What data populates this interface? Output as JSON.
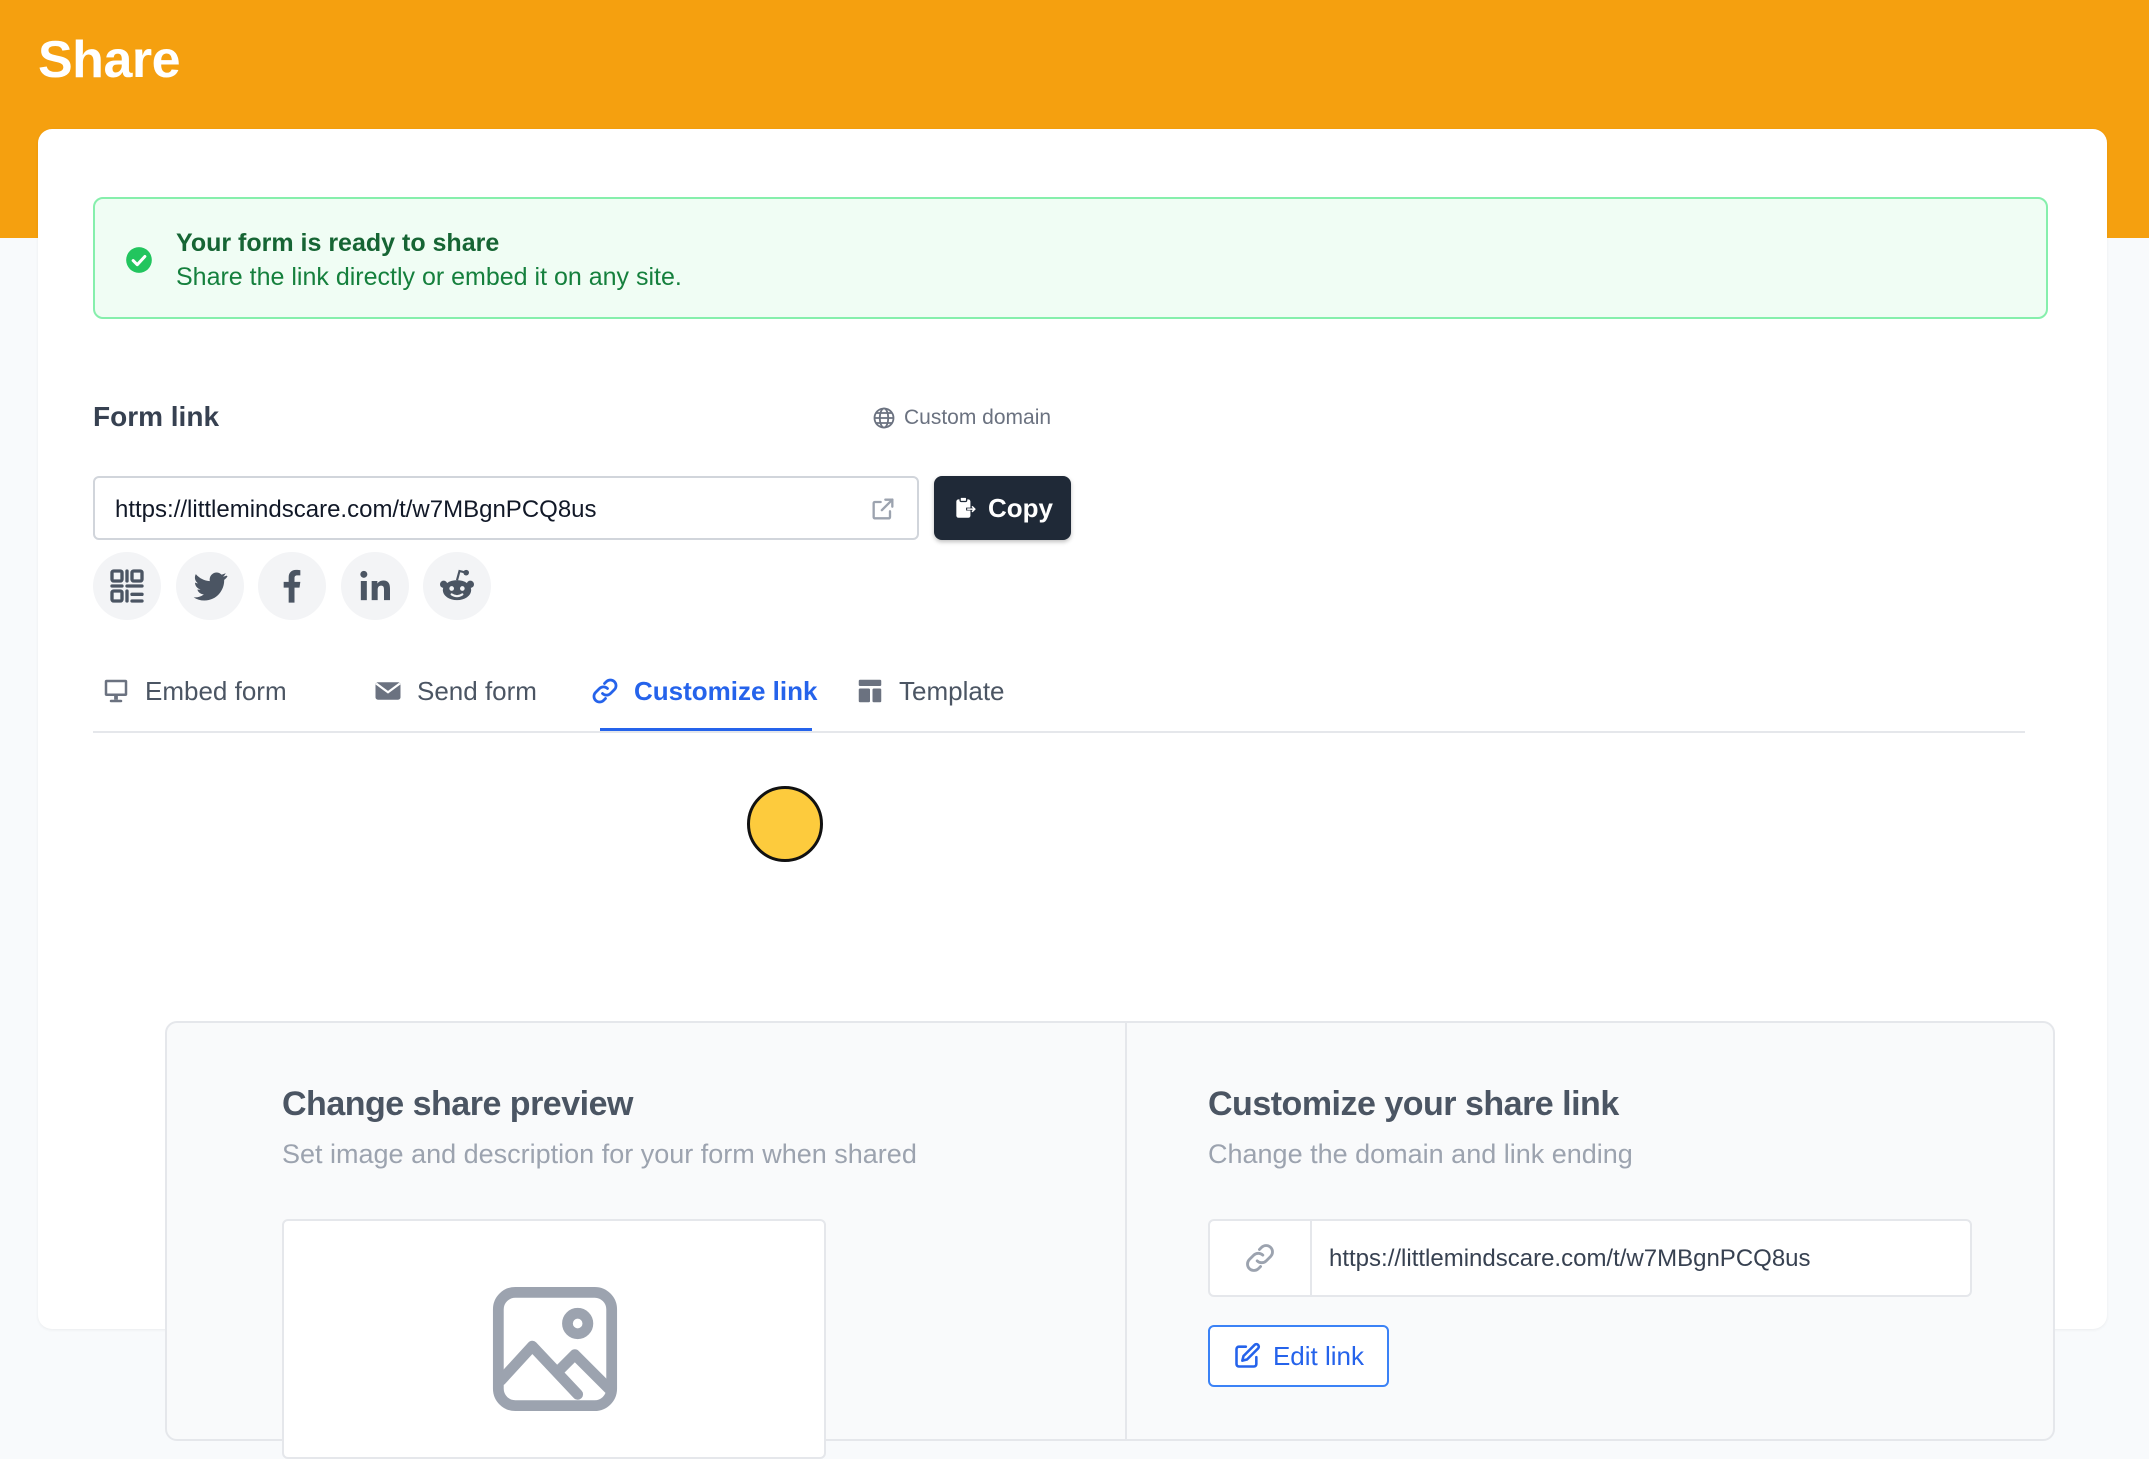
{
  "header": {
    "title": "Share"
  },
  "alert": {
    "title": "Your form is ready to share",
    "subtitle": "Share the link directly or embed it on any site."
  },
  "form_link": {
    "label": "Form link",
    "custom_domain": "Custom domain",
    "url": "https://littlemindscare.com/t/w7MBgnPCQ8us",
    "copy_label": "Copy"
  },
  "social": [
    {
      "icon": "qr-code-icon"
    },
    {
      "icon": "twitter-icon"
    },
    {
      "icon": "facebook-icon"
    },
    {
      "icon": "linkedin-icon"
    },
    {
      "icon": "reddit-icon"
    }
  ],
  "tabs": [
    {
      "label": "Embed form",
      "icon": "monitor-icon",
      "active": false
    },
    {
      "label": "Send form",
      "icon": "envelope-icon",
      "active": false
    },
    {
      "label": "Customize link",
      "icon": "link-icon",
      "active": true
    },
    {
      "label": "Template",
      "icon": "template-icon",
      "active": false
    }
  ],
  "share_preview": {
    "title": "Change share preview",
    "subtitle": "Set image and description for your form when shared"
  },
  "customize_link": {
    "title": "Customize your share link",
    "subtitle": "Change the domain and link ending",
    "url": "https://littlemindscare.com/t/w7MBgnPCQ8us",
    "edit_label": "Edit link"
  },
  "colors": {
    "header_bg": "#f5a00f",
    "accent": "#2563eb",
    "success": "#16a34a",
    "dark_button": "#1f2937",
    "cursor": "#fdcb3d"
  }
}
